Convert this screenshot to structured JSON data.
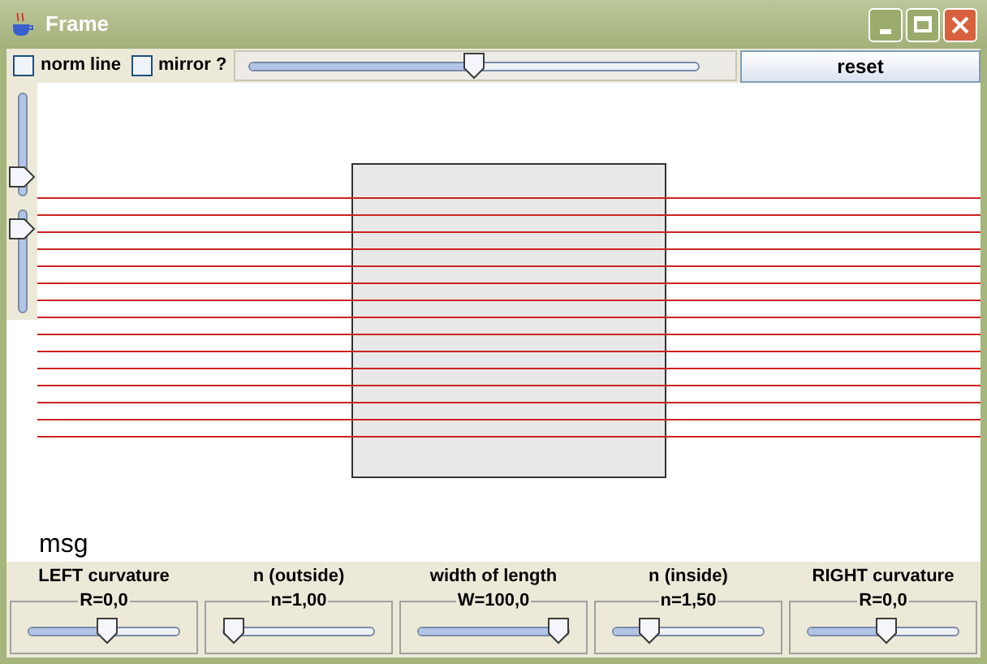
{
  "window": {
    "title": "Frame"
  },
  "toolbar": {
    "checkboxes": [
      {
        "label": "norm line",
        "checked": false
      },
      {
        "label": "mirror ?",
        "checked": false
      }
    ],
    "slider": {
      "level": 0.5
    },
    "reset_button": "reset"
  },
  "side_sliders": [
    {
      "level": 0.1
    },
    {
      "level": 0.9
    }
  ],
  "message": "msg",
  "controls": [
    {
      "label": "LEFT curvature",
      "value": "R=0,0",
      "level": 0.53
    },
    {
      "label": "n (outside)",
      "value": "n=1,00",
      "level": 0.0
    },
    {
      "label": "width of length",
      "value": "W=100,0",
      "level": 1.0
    },
    {
      "label": "n (inside)",
      "value": "n=1,50",
      "level": 0.2
    },
    {
      "label": "RIGHT curvature",
      "value": "R=0,0",
      "level": 0.52
    }
  ]
}
